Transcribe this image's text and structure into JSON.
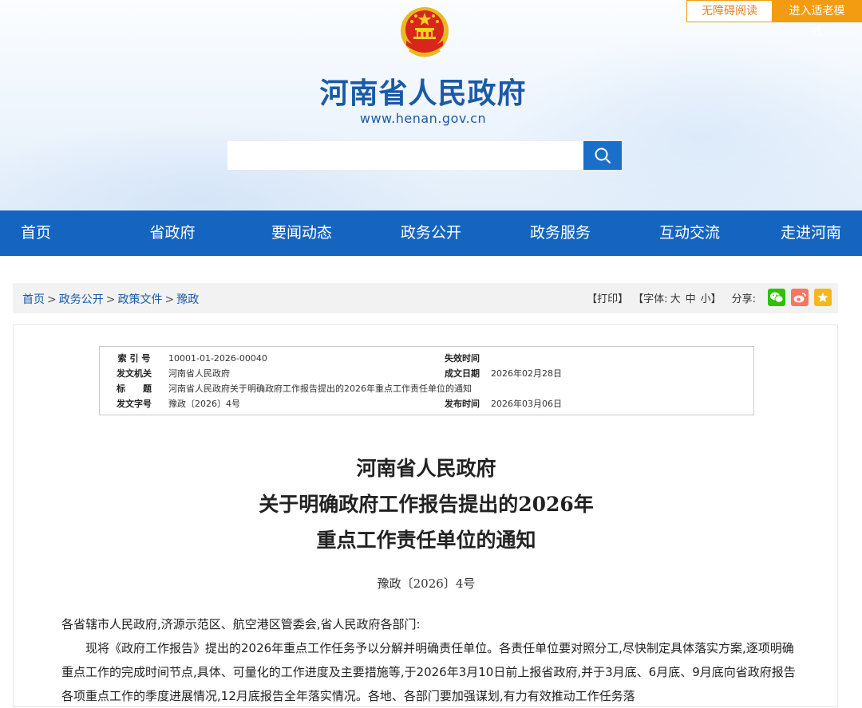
{
  "top_buttons": {
    "accessibility": "无障碍阅读",
    "elder_mode": "进入适老模式"
  },
  "site": {
    "title": "河南省人民政府",
    "url": "www.henan.gov.cn"
  },
  "search": {
    "placeholder": ""
  },
  "nav": [
    "首页",
    "省政府",
    "要闻动态",
    "政务公开",
    "政务服务",
    "互动交流",
    "走进河南"
  ],
  "breadcrumb": [
    "首页",
    "政务公开",
    "政策文件",
    "豫政"
  ],
  "breadcrumb_sep": ">",
  "tools": {
    "print": "【打印】",
    "font_label": "【字体:",
    "font_large": "大",
    "font_medium": "中",
    "font_small": "小】",
    "share_label": "分享:"
  },
  "meta": {
    "index_label": "索 引 号",
    "index_value": "10001-01-2026-00040",
    "expire_label": "失效时间",
    "expire_value": "",
    "issuer_label": "发文机关",
    "issuer_value": "河南省人民政府",
    "date_label": "成文日期",
    "date_value": "2026年02月28日",
    "title_label": "标　　题",
    "title_value": "河南省人民政府关于明确政府工作报告提出的2026年重点工作责任单位的通知",
    "docno_label": "发文字号",
    "docno_value": "豫政〔2026〕4号",
    "publish_label": "发布时间",
    "publish_value": "2026年03月06日"
  },
  "doc": {
    "title_line1": "河南省人民政府",
    "title_line2": "关于明确政府工作报告提出的2026年",
    "title_line3": "重点工作责任单位的通知",
    "number": "豫政〔2026〕4号",
    "salutation": "各省辖市人民政府,济源示范区、航空港区管委会,省人民政府各部门:",
    "paragraph1": "现将《政府工作报告》提出的2026年重点工作任务予以分解并明确责任单位。各责任单位要对照分工,尽快制定具体落实方案,逐项明确重点工作的完成时间节点,具体、可量化的工作进度及主要措施等,于2026年3月10日前上报省政府,并于3月底、6月底、9月底向省政府报告各项重点工作的季度进展情况,12月底报告全年落实情况。各地、各部门要加强谋划,有力有效推动工作任务落"
  },
  "colors": {
    "nav_bg": "#1565c0",
    "brand_blue": "#1a5aa6",
    "accent_orange": "#f39c12"
  }
}
